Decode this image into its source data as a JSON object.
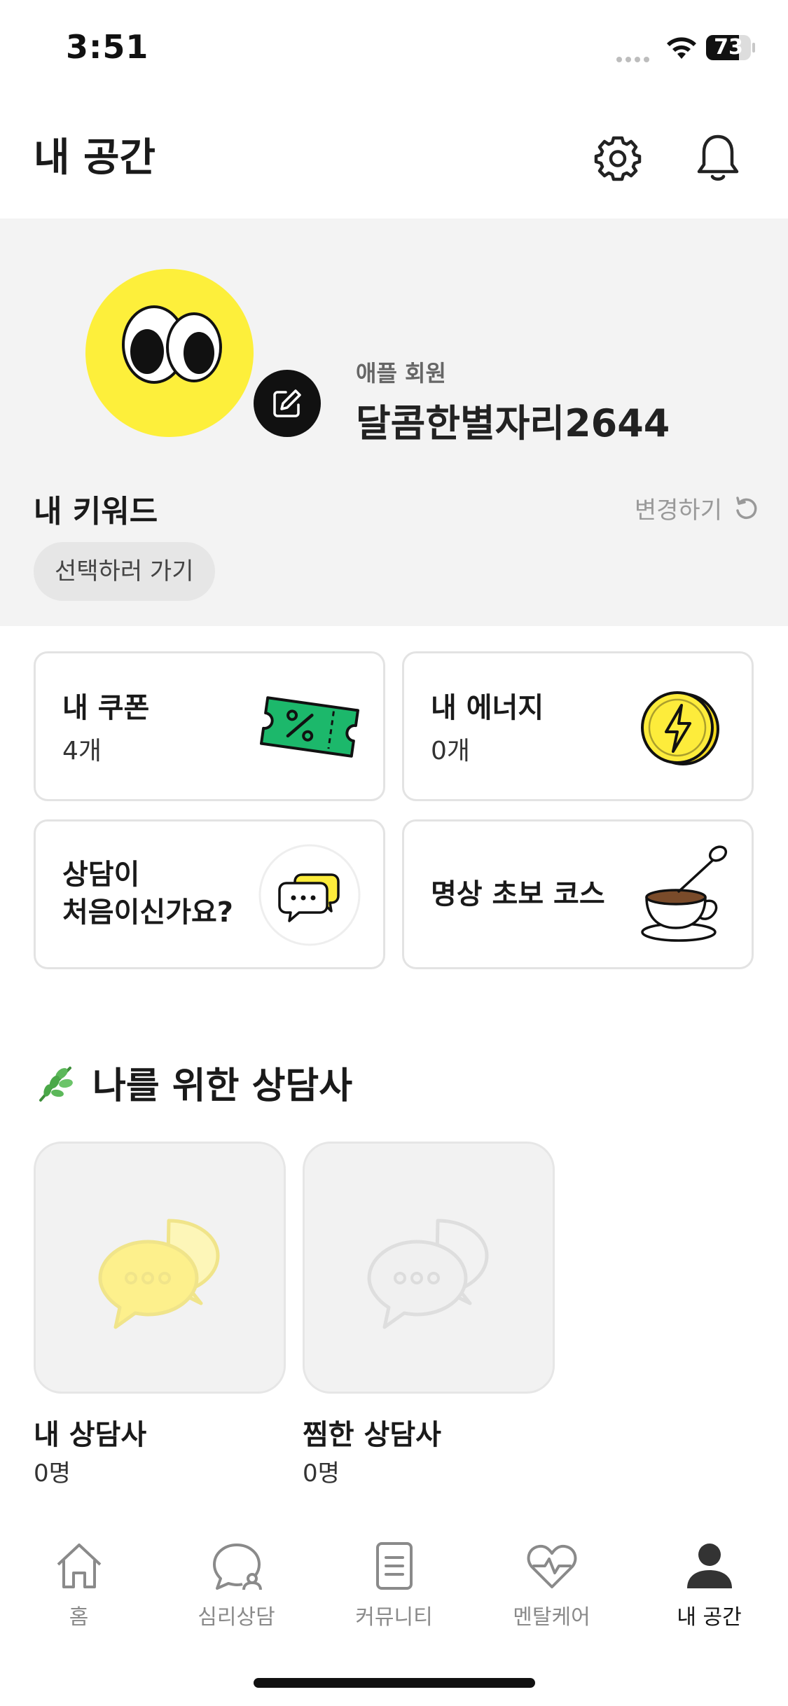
{
  "status_bar": {
    "time": "3:51",
    "battery": "73",
    "battery_level": 0.73
  },
  "header": {
    "title": "내 공간",
    "settings_icon": "gear-icon",
    "notifications_icon": "bell-icon"
  },
  "profile": {
    "member_type": "애플 회원",
    "nickname": "달콤한별자리2644",
    "avatar_color": "#fdef3b",
    "keyword_title": "내 키워드",
    "change_label": "변경하기",
    "keyword_chip": "선택하러 가기"
  },
  "cards": {
    "coupon": {
      "title": "내 쿠폰",
      "count": "4개"
    },
    "energy": {
      "title": "내 에너지",
      "count": "0개"
    },
    "first_counsel": {
      "title_line1": "상담이",
      "title_line2": "처음이신가요?"
    },
    "meditation": {
      "title": "명상 초보 코스"
    }
  },
  "counselors": {
    "section_title": "나를 위한 상담사",
    "mine": {
      "label": "내 상담사",
      "count": "0명"
    },
    "liked": {
      "label": "찜한 상담사",
      "count": "0명"
    }
  },
  "tabs": [
    {
      "label": "홈",
      "icon": "home-icon"
    },
    {
      "label": "심리상담",
      "icon": "counseling-chat-icon"
    },
    {
      "label": "커뮤니티",
      "icon": "community-document-icon"
    },
    {
      "label": "멘탈케어",
      "icon": "heart-pulse-icon"
    },
    {
      "label": "내 공간",
      "icon": "person-icon",
      "active": true
    }
  ],
  "colors": {
    "accent_yellow": "#fdef3b",
    "coupon_green": "#1cb86b",
    "text": "#1a1a1a"
  }
}
